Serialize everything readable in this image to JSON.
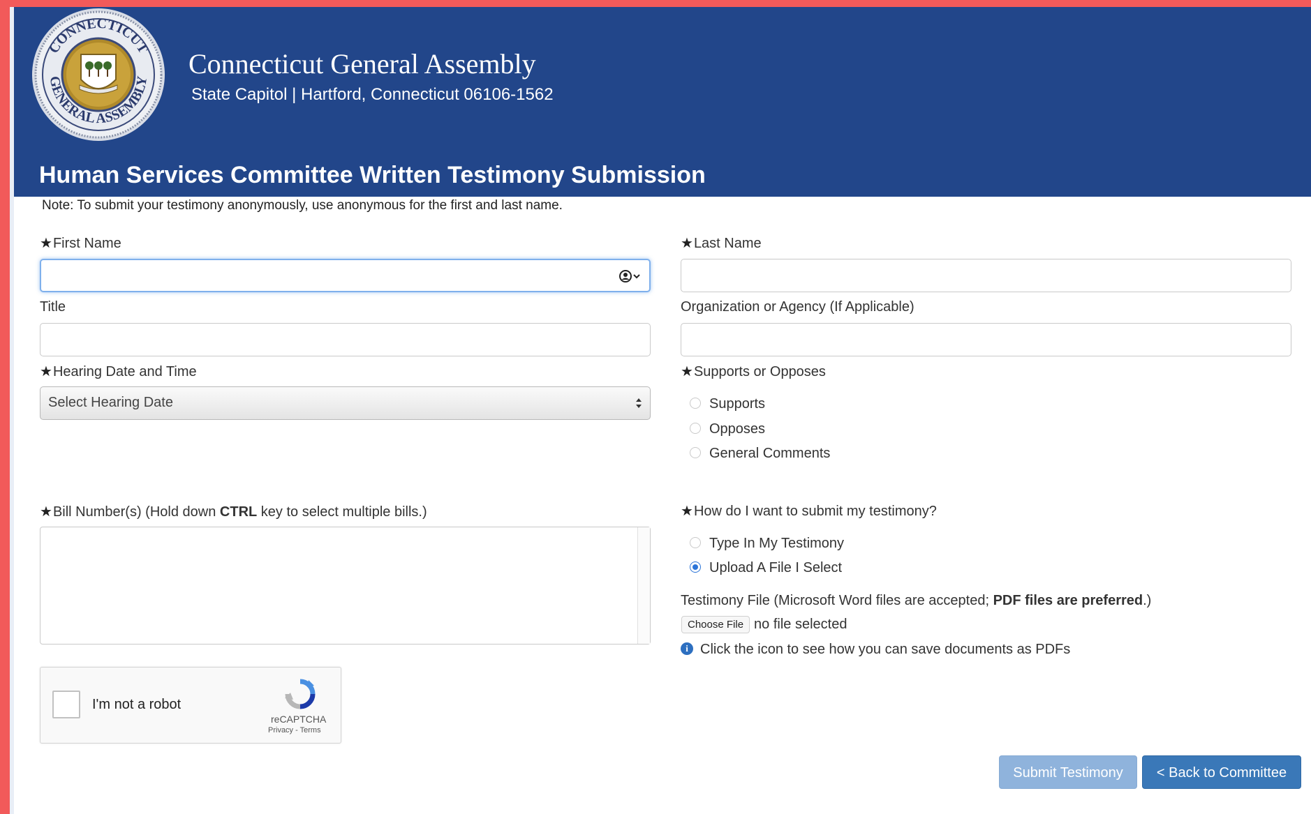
{
  "header": {
    "site_title": "Connecticut General Assembly",
    "site_address": "State Capitol | Hartford, Connecticut 06106-1562",
    "seal_text_top": "CONNECTICUT",
    "seal_text_bottom": "GENERAL ASSEMBLY",
    "page_title": "Human Services Committee Written Testimony Submission"
  },
  "colors": {
    "header_bg": "#22468a",
    "frame": "#f25a5a",
    "primary_button": "#3a78b8",
    "disabled_button": "#8fb3dc"
  },
  "form": {
    "note": "Note: To submit your testimony anonymously, use anonymous for the first and last name.",
    "required_marker": "★",
    "first_name": {
      "label": "First Name",
      "value": ""
    },
    "last_name": {
      "label": "Last Name",
      "value": ""
    },
    "title": {
      "label": "Title",
      "value": ""
    },
    "organization": {
      "label": "Organization or Agency (If Applicable)",
      "value": ""
    },
    "hearing": {
      "label": "Hearing Date and Time",
      "selected": "Select Hearing Date"
    },
    "position": {
      "label": "Supports or Opposes",
      "options": [
        {
          "label": "Supports",
          "checked": false
        },
        {
          "label": "Opposes",
          "checked": false
        },
        {
          "label": "General Comments",
          "checked": false
        }
      ]
    },
    "bills": {
      "label_prefix": "Bill Number(s) (Hold down ",
      "label_key": "CTRL",
      "label_suffix": " key to select multiple bills.)"
    },
    "submit_method": {
      "label": "How do I want to submit my testimony?",
      "options": [
        {
          "label": "Type In My Testimony",
          "checked": false
        },
        {
          "label": "Upload A File I Select",
          "checked": true
        }
      ]
    },
    "testimony_file": {
      "label_prefix": "Testimony File (Microsoft Word files are accepted; ",
      "label_bold": "PDF files are preferred",
      "label_suffix": ".)",
      "choose_label": "Choose File",
      "status": "no file selected"
    },
    "pdf_help": {
      "icon": "info-icon",
      "text": "Click the icon to see how you can save documents as PDFs"
    }
  },
  "captcha": {
    "label": "I'm not a robot",
    "brand": "reCAPTCHA",
    "links": "Privacy - Terms"
  },
  "buttons": {
    "submit": "Submit Testimony",
    "back": "< Back to Committee"
  }
}
